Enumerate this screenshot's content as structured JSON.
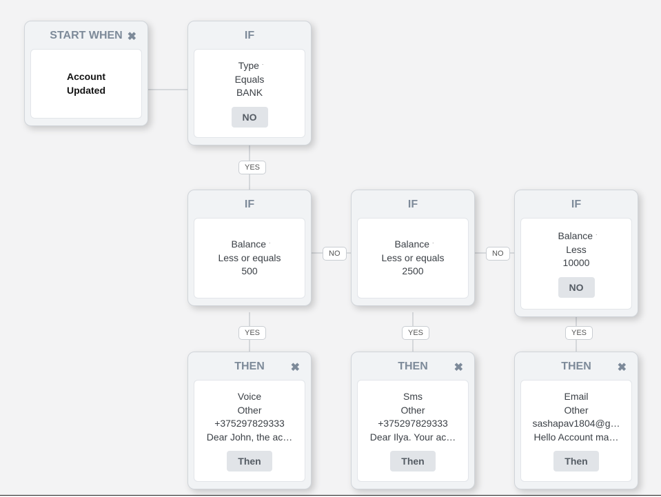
{
  "nodes": {
    "start": {
      "title": "START WHEN",
      "close_icon": "✖",
      "body_line1": "Account",
      "body_line2": "Updated"
    },
    "if1": {
      "title": "IF",
      "field": "Type",
      "op": "Equals",
      "value": "BANK",
      "btn": "NO"
    },
    "if2": {
      "title": "IF",
      "field": "Balance",
      "op": "Less or equals",
      "value": "500"
    },
    "if3": {
      "title": "IF",
      "field": "Balance",
      "op": "Less or equals",
      "value": "2500"
    },
    "if4": {
      "title": "IF",
      "field": "Balance",
      "op": "Less",
      "value": "10000",
      "btn": "NO"
    },
    "then1": {
      "title": "THEN",
      "close_icon": "✖",
      "l1": "Voice",
      "l2": "Other",
      "l3": "+375297829333",
      "l4": "Dear John, the ac…",
      "btn": "Then"
    },
    "then2": {
      "title": "THEN",
      "close_icon": "✖",
      "l1": "Sms",
      "l2": "Other",
      "l3": "+375297829333",
      "l4": "Dear Ilya. Your ac…",
      "btn": "Then"
    },
    "then3": {
      "title": "THEN",
      "close_icon": "✖",
      "l1": "Email",
      "l2": "Other",
      "l3": "sashapav1804@g…",
      "l4": "Hello Account ma…",
      "btn": "Then"
    }
  },
  "labels": {
    "yes": "YES",
    "no": "NO"
  }
}
